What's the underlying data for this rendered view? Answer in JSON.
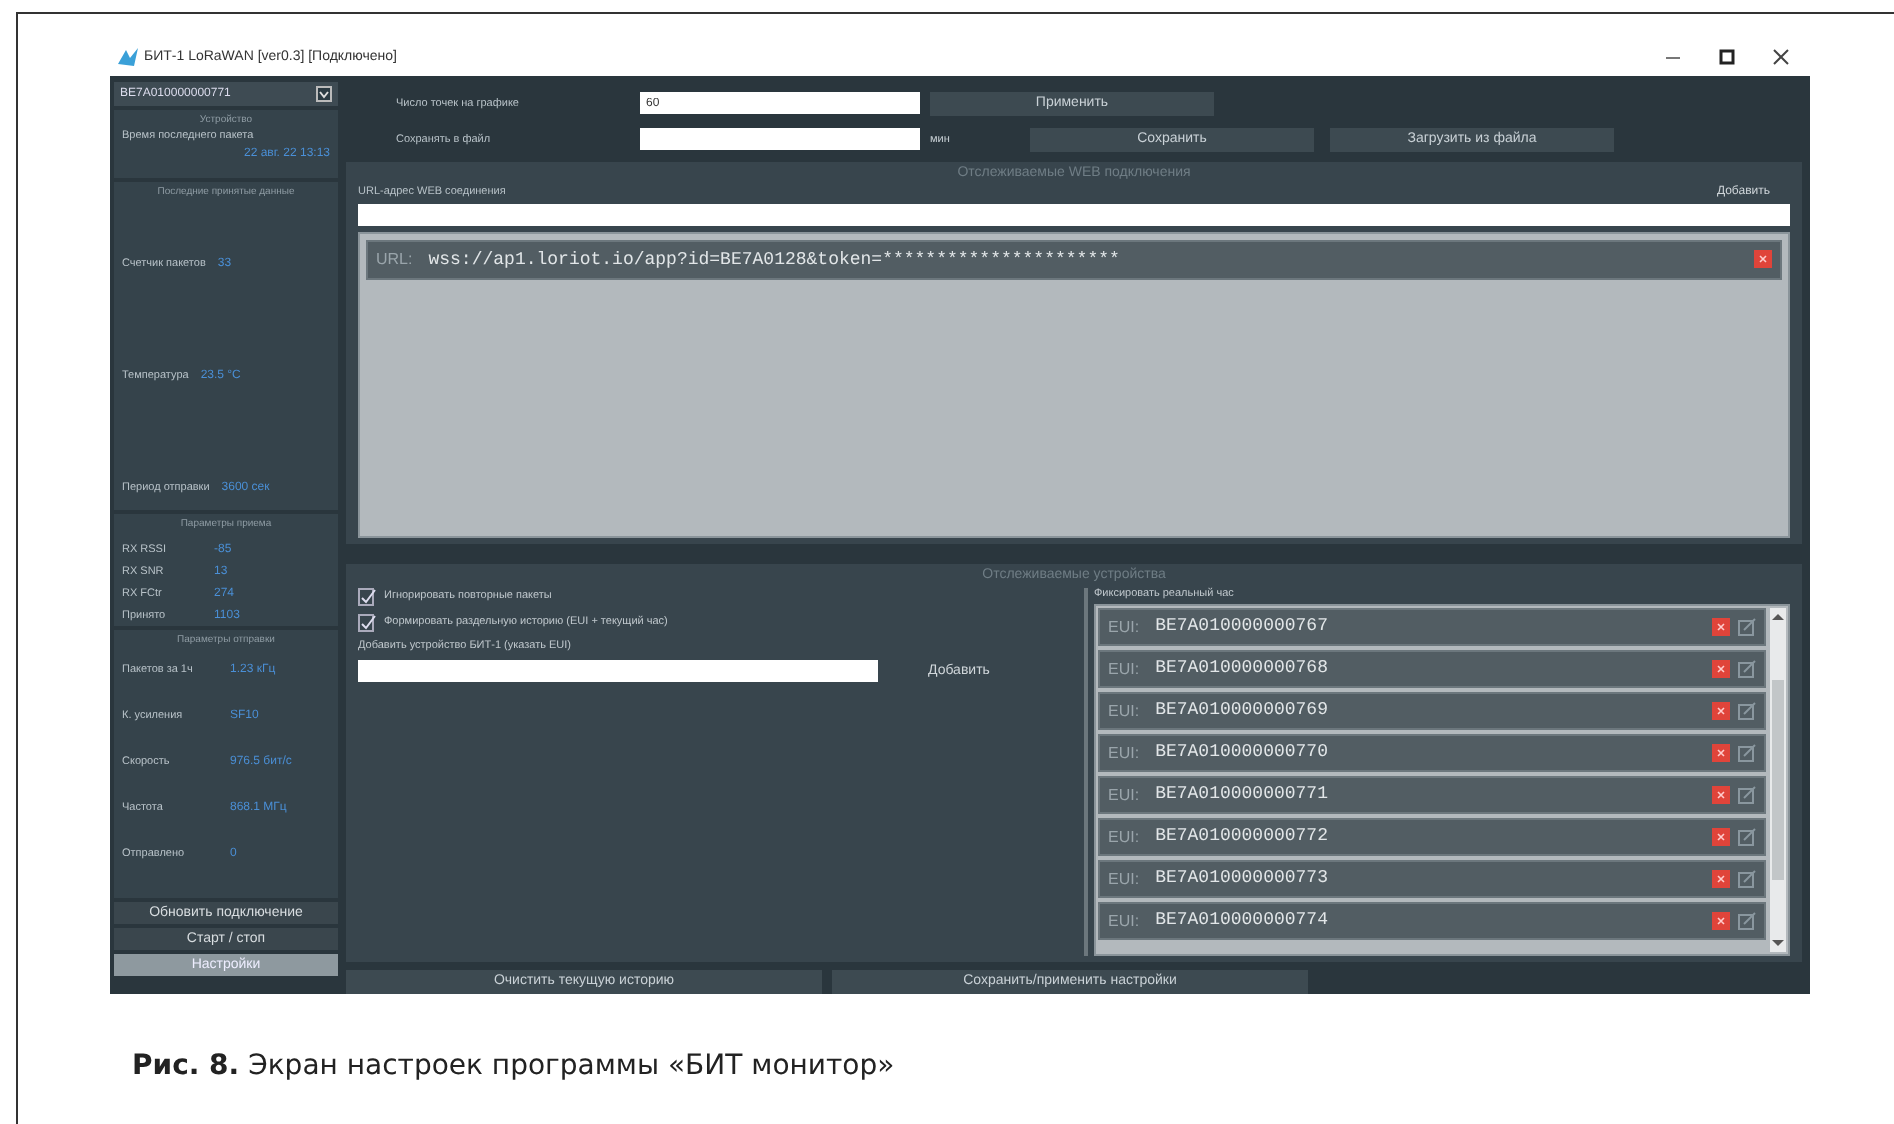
{
  "window": {
    "title": "БИТ-1 LoRaWAN [ver0.3] [Подключено]"
  },
  "sidebar": {
    "device": "BE7A010000000771",
    "groups": [
      {
        "title": "Устройство",
        "rows": [
          {
            "label": "Время последнего пакета",
            "value": "22 авг. 22 13:13"
          }
        ]
      },
      {
        "title": "Последние принятые данные",
        "rows": [
          {
            "label": "Счетчик пакетов",
            "value": "33"
          },
          {
            "label": "Температура",
            "value": "23.5 °C"
          },
          {
            "label": "Период отправки",
            "value": "3600 сек"
          }
        ]
      },
      {
        "title": "Параметры приема",
        "rows": [
          {
            "label": "RX RSSI",
            "value": "-85"
          },
          {
            "label": "RX SNR",
            "value": "13"
          },
          {
            "label": "RX FCtr",
            "value": "274"
          },
          {
            "label": "Принято",
            "value": "1103"
          }
        ]
      },
      {
        "title": "Параметры отправки",
        "rows": [
          {
            "label": "Пакетов за 1ч",
            "value": "1.23 кГц"
          },
          {
            "label": "К. усиления",
            "value": "SF10"
          },
          {
            "label": "Скорость",
            "value": "976.5 бит/с"
          },
          {
            "label": "Частота",
            "value": "868.1 МГц"
          },
          {
            "label": "Отправлено",
            "value": "0"
          }
        ]
      }
    ],
    "buttons": [
      {
        "label": "Обновить подключение",
        "selected": false
      },
      {
        "label": "Старт / стоп",
        "selected": false
      },
      {
        "label": "Настройки",
        "selected": true
      }
    ]
  },
  "settings": {
    "points_label": "Число точек на графике",
    "points_value": "60",
    "apply": "Применить",
    "save_label": "Сохранять в файл",
    "unit": "мин",
    "save": "Сохранить",
    "load": "Загрузить из файла"
  },
  "web": {
    "title": "Отслеживаемые WEB подключения",
    "label": "URL-адрес WEB соединения",
    "add": "Добавить",
    "items": [
      {
        "prefix": "URL:",
        "value": "wss://ap1.loriot.io/app?id=BE7A0128&token=**********************"
      }
    ]
  },
  "devices": {
    "title": "Отслеживаемые устройства",
    "options": [
      {
        "label": "Игнорировать повторные пакеты",
        "checked": true
      },
      {
        "label": "Формировать раздельную историю (EUI + текущий час)",
        "checked": true
      }
    ],
    "add_label": "Добавить устройство БИТ-1 (указать EUI)",
    "add": "Добавить",
    "list_label": "Фиксировать реальный час",
    "items": [
      {
        "prefix": "EUI:",
        "value": "BE7A010000000767"
      },
      {
        "prefix": "EUI:",
        "value": "BE7A010000000768"
      },
      {
        "prefix": "EUI:",
        "value": "BE7A010000000769"
      },
      {
        "prefix": "EUI:",
        "value": "BE7A010000000770"
      },
      {
        "prefix": "EUI:",
        "value": "BE7A010000000771"
      },
      {
        "prefix": "EUI:",
        "value": "BE7A010000000772"
      },
      {
        "prefix": "EUI:",
        "value": "BE7A010000000773"
      },
      {
        "prefix": "EUI:",
        "value": "BE7A010000000774"
      }
    ]
  },
  "bottom_buttons": [
    "Очистить текущую историю",
    "Сохранить/применить настройки"
  ],
  "caption": "**Рис. 8.** Экран настроек программы «БИТ монитор»"
}
